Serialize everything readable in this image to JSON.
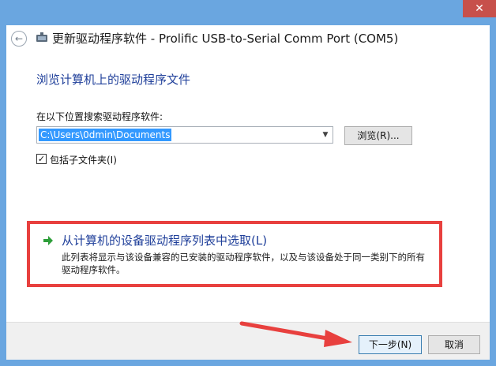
{
  "window": {
    "close_glyph": "✕",
    "title": "更新驱动程序软件 - Prolific USB-to-Serial Comm Port (COM5)"
  },
  "page": {
    "heading": "浏览计算机上的驱动程序文件",
    "search_label": "在以下位置搜索驱动程序软件:",
    "path_value": "C:\\Users\\0dmin\\Documents",
    "browse_label": "浏览(R)...",
    "include_subfolders_label": "包括子文件夹(I)",
    "include_subfolders_checked": true
  },
  "pick_option": {
    "title": "从计算机的设备驱动程序列表中选取(L)",
    "description": "此列表将显示与该设备兼容的已安装的驱动程序软件，以及与该设备处于同一类别下的所有驱动程序软件。"
  },
  "footer": {
    "next_label": "下一步(N)",
    "cancel_label": "取消"
  },
  "colors": {
    "frame": "#6aa6e0",
    "heading_blue": "#1f3f9a",
    "highlight_red": "#e8403e",
    "close_red": "#c7504b"
  },
  "icons": {
    "back": "back-arrow-icon",
    "device": "usb-device-icon",
    "pick": "green-arrow-icon",
    "dropdown": "chevron-down-icon"
  }
}
